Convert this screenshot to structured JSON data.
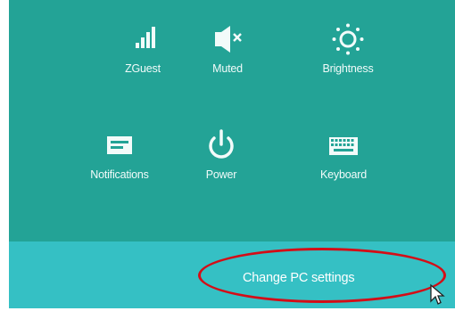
{
  "quick_settings": [
    {
      "id": "network",
      "icon": "network-signal-icon",
      "label": "ZGuest"
    },
    {
      "id": "volume",
      "icon": "speaker-muted-icon",
      "label": "Muted"
    },
    {
      "id": "brightness",
      "icon": "brightness-sun-icon",
      "label": "Brightness"
    },
    {
      "id": "notifications",
      "icon": "notifications-icon",
      "label": "Notifications"
    },
    {
      "id": "power",
      "icon": "power-icon",
      "label": "Power"
    },
    {
      "id": "keyboard",
      "icon": "keyboard-icon",
      "label": "Keyboard"
    }
  ],
  "footer": {
    "change_pc_settings": "Change PC settings"
  },
  "colors": {
    "panel_bg": "#23a396",
    "footer_bg": "#35c0c4",
    "highlight": "#d40d17",
    "text": "#f2fbfa"
  }
}
